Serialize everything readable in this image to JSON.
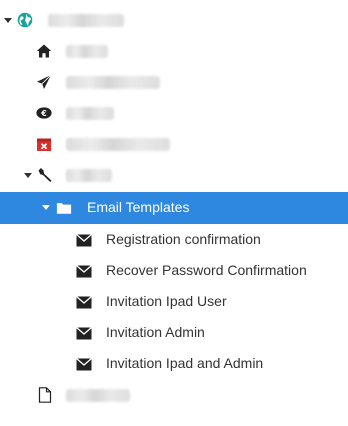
{
  "tree": {
    "selected_label": "Email Templates",
    "email_items": [
      "Registration confirmation",
      "Recover Password Confirmation",
      "Invitation Ipad User",
      "Invitation Admin",
      "Invitation Ipad and Admin"
    ],
    "icons": {
      "root": "globe-icon",
      "home": "home-icon",
      "send": "paper-plane-icon",
      "money": "euro-badge-icon",
      "calendar": "calendar-x-icon",
      "tools": "wrench-icon",
      "folder": "folder-icon",
      "mail": "envelope-icon",
      "doc": "document-icon"
    },
    "colors": {
      "selection": "#2f88e0",
      "globe": "#1aa39a",
      "calendar_x": "#d9302c"
    }
  }
}
